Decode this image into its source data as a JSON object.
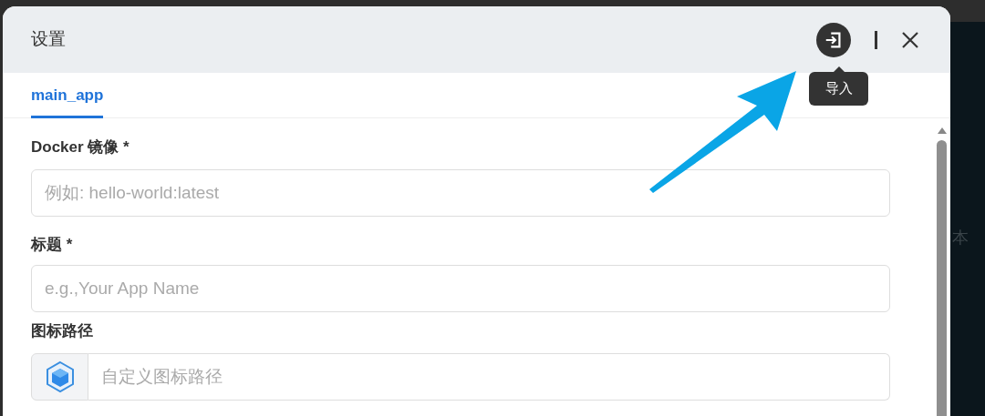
{
  "background": {
    "text": "本"
  },
  "dialog": {
    "title": "设置",
    "import_button": {
      "tooltip": "导入"
    },
    "tabs": [
      {
        "label": "main_app",
        "selected": true
      }
    ],
    "fields": [
      {
        "label": "Docker 镜像 *",
        "placeholder": "例如: hello-world:latest",
        "kind": "text"
      },
      {
        "label": "标题 *",
        "placeholder": "e.g.,Your App Name",
        "kind": "text"
      },
      {
        "label": "图标路径",
        "placeholder": "自定义图标路径",
        "kind": "icon"
      }
    ]
  }
}
